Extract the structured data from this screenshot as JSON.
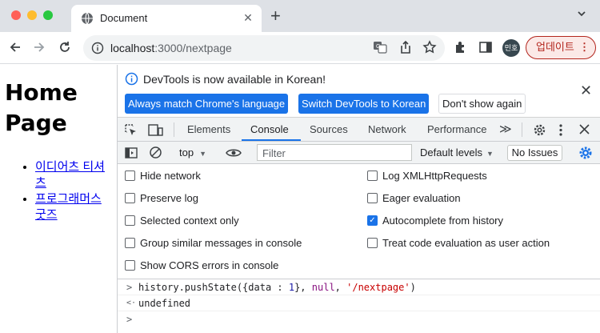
{
  "browser": {
    "tab_title": "Document",
    "url_host": "localhost",
    "url_rest": ":3000/nextpage",
    "avatar_text": "민호",
    "update_label": "업데이트",
    "update_menu": "⋮",
    "tab_close": "✕",
    "new_tab": "+",
    "colors": {
      "accent": "#1a73e8",
      "update": "#b3261e",
      "tabstrip": "#dee1e6"
    }
  },
  "page": {
    "heading": "Home Page",
    "links": [
      "이디어츠 티셔츠",
      "프로그래머스 굿즈"
    ]
  },
  "devtools": {
    "infobar": {
      "message": "DevTools is now available in Korean!",
      "buttons": [
        "Always match Chrome's language",
        "Switch DevTools to Korean",
        "Don't show again"
      ]
    },
    "tabs": [
      "Elements",
      "Console",
      "Sources",
      "Network",
      "Performance"
    ],
    "active_tab": "Console",
    "overflow": "≫",
    "console_bar": {
      "context": "top",
      "filter_placeholder": "Filter",
      "levels": "Default levels",
      "issues": "No Issues"
    },
    "settings": {
      "left": [
        {
          "label": "Hide network",
          "checked": false
        },
        {
          "label": "Preserve log",
          "checked": false
        },
        {
          "label": "Selected context only",
          "checked": false
        },
        {
          "label": "Group similar messages in console",
          "checked": false
        },
        {
          "label": "Show CORS errors in console",
          "checked": false
        }
      ],
      "right": [
        {
          "label": "Log XMLHttpRequests",
          "checked": false
        },
        {
          "label": "Eager evaluation",
          "checked": false
        },
        {
          "label": "Autocomplete from history",
          "checked": true
        },
        {
          "label": "Treat code evaluation as user action",
          "checked": false
        }
      ]
    },
    "console_output": {
      "input_prefix": ">",
      "input_fn": "history.pushState({data : ",
      "input_num": "1",
      "input_mid1": "}, ",
      "input_null": "null",
      "input_mid2": ", ",
      "input_str": "'/nextpage'",
      "input_end": ")",
      "result_prefix": "<·",
      "result": "undefined",
      "prompt": ">"
    }
  }
}
